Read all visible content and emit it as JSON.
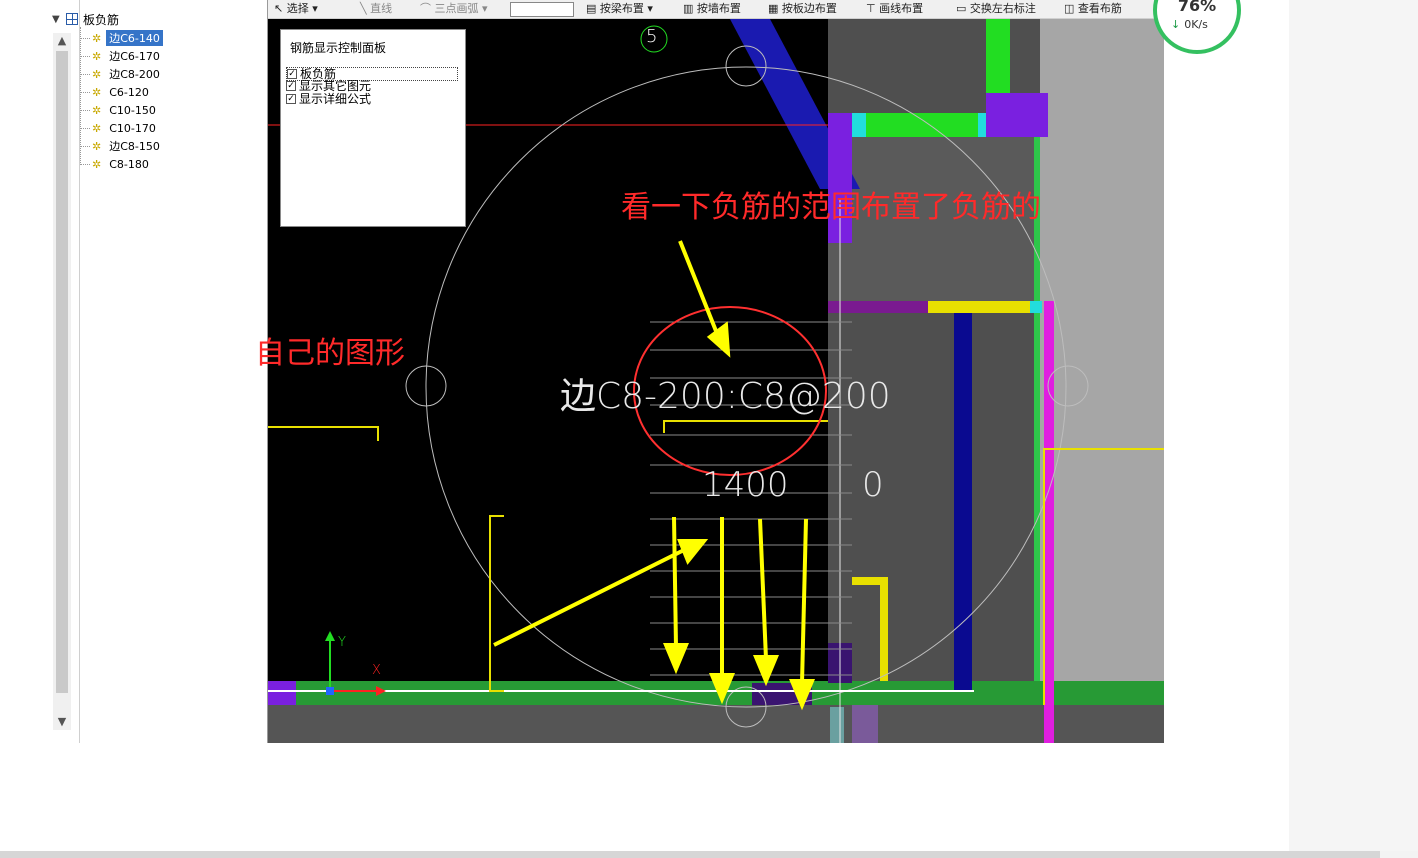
{
  "tree": {
    "root_label": "板负筋",
    "items": [
      "边C6-140",
      "边C6-170",
      "边C8-200",
      "C6-120",
      "C10-150",
      "C10-170",
      "边C8-150",
      "C8-180"
    ],
    "selected_index": 0
  },
  "toolbar": {
    "select_label": "选择",
    "line_label": "直线",
    "arc_label": "三点画弧",
    "beam_label": "按梁布置",
    "wall_label": "按墙布置",
    "slab_edge_label": "按板边布置",
    "draw_line_label": "画线布置",
    "swap_label": "交换左右标注",
    "view_label": "查看布筋"
  },
  "speed_widget": {
    "percent": "76%",
    "rate": "0K/s"
  },
  "control_panel": {
    "title": "钢筋显示控制面板",
    "options": [
      "板负筋",
      "显示其它图元",
      "显示详细公式"
    ]
  },
  "cad": {
    "axis_number": "5",
    "rebar_label": "边C8-200:C8@200",
    "length_label": "1400",
    "side_label": "0",
    "axis_x": "X",
    "axis_y": "Y"
  },
  "annotations": {
    "own_shape": "自己的图形",
    "check_range": "看一下负筋的范围布置了负筋的"
  },
  "colors": {
    "annotation_red": "#ff2a2a",
    "arrow_yellow": "#ffff00",
    "selection_blue": "#3574c8",
    "speed_green": "#34c060"
  }
}
